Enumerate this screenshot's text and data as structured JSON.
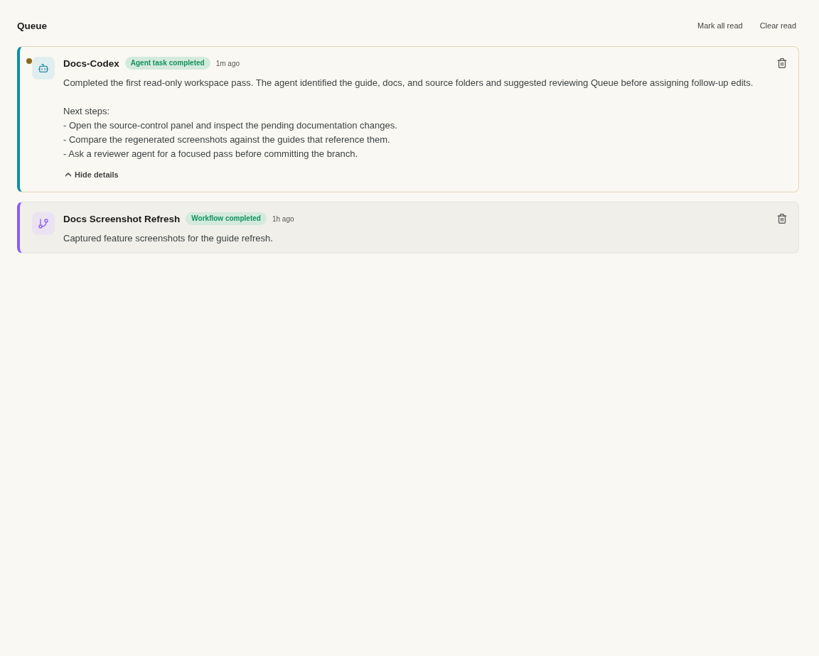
{
  "header": {
    "title": "Queue",
    "actions": [
      "Mark all read",
      "Clear read"
    ]
  },
  "notifications": [
    {
      "kind": "agent",
      "unread": true,
      "title": "Docs-Codex",
      "badge": "Agent task completed",
      "time": "1m ago",
      "summary": "Completed the first read-only workspace pass. The agent identified the guide, docs, and source folders and suggested reviewing Queue before assigning follow-up edits.",
      "details_heading": "Next steps:",
      "details": [
        "- Open the source-control panel and inspect the pending documentation changes.",
        "- Compare the regenerated screenshots against the guides that reference them.",
        "- Ask a reviewer agent for a focused pass before committing the branch."
      ],
      "expanded": true,
      "details_toggle": "Hide details"
    },
    {
      "kind": "workflow",
      "unread": false,
      "title": "Docs Screenshot Refresh",
      "badge": "Workflow completed",
      "time": "1h ago",
      "summary": "Captured feature screenshots for the guide refresh."
    }
  ]
}
